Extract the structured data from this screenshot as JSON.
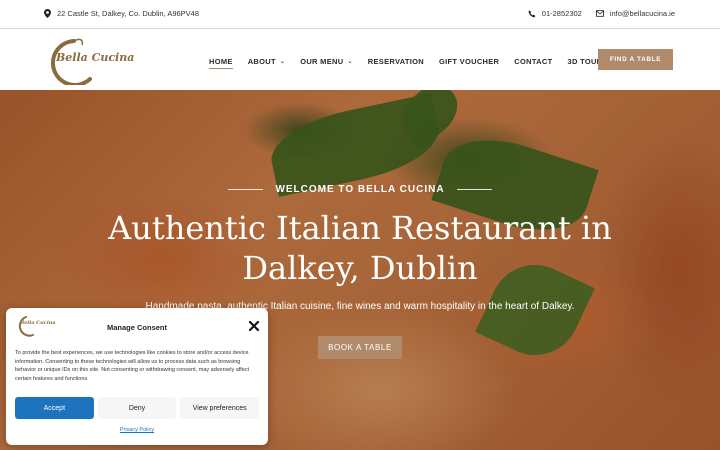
{
  "topbar": {
    "address": "22 Castle St, Dalkey, Co. Dublin, A96PV48",
    "phone": "01-2852302",
    "email": "info@bellacucina.ie"
  },
  "header": {
    "logo_text": "Bella Cucina",
    "nav": [
      {
        "label": "HOME",
        "active": true
      },
      {
        "label": "ABOUT",
        "dropdown": true
      },
      {
        "label": "OUR MENU",
        "dropdown": true
      },
      {
        "label": "RESERVATION"
      },
      {
        "label": "GIFT VOUCHER"
      },
      {
        "label": "CONTACT"
      },
      {
        "label": "3D TOUR"
      }
    ],
    "cta": "FIND A TABLE"
  },
  "hero": {
    "welcome": "WELCOME TO BELLA CUCINA",
    "title": "Authentic Italian Restaurant in Dalkey, Dublin",
    "subtitle": "Handmade pasta, authentic Italian cuisine, fine wines and warm hospitality in the heart of Dalkey.",
    "cta": "BOOK A TABLE"
  },
  "consent": {
    "logo_text": "Bella Cucina",
    "title": "Manage Consent",
    "text": "To provide the best experiences, we use technologies like cookies to store and/or access device information. Consenting to these technologies will allow us to process data such as browsing behavior or unique IDs on this site. Not consenting or withdrawing consent, may adversely affect certain features and functions.",
    "accept": "Accept",
    "deny": "Deny",
    "preferences": "View preferences",
    "policy": "Privacy Policy"
  },
  "colors": {
    "accent": "#b08a6a",
    "consent_accept": "#1e73be"
  }
}
